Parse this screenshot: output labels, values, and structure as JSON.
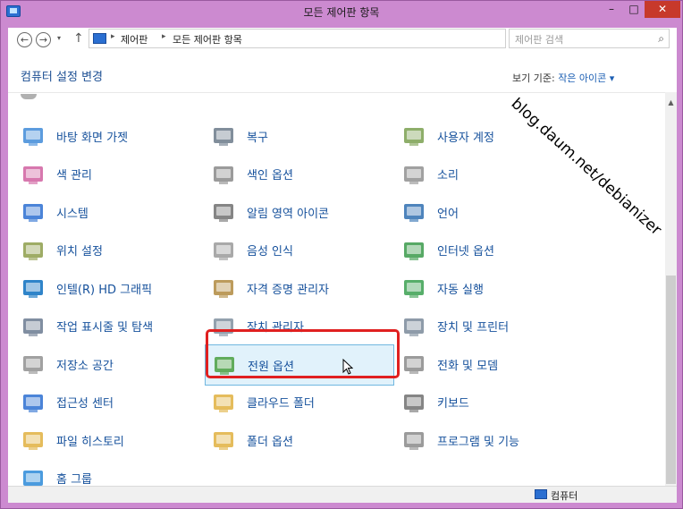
{
  "window": {
    "title": "모든 제어판 항목",
    "min": "–",
    "max": "□",
    "close": "✕"
  },
  "nav": {
    "back": "←",
    "forward": "→",
    "history": "▾",
    "up": "↑",
    "crumbs": [
      "제어판",
      "모든 제어판 항목"
    ],
    "separator": "▸",
    "dropdown": "⌄",
    "refresh": "↻",
    "search_placeholder": "제어판 검색",
    "search_icon": "⌕"
  },
  "heading": "컴퓨터 설정 변경",
  "view_by": {
    "label": "보기 기준:",
    "value": "작은 아이콘 ▾"
  },
  "items": [
    {
      "label": "바탕 화면 가젯",
      "icon": "gadgets-icon",
      "color": "#3f8bd8"
    },
    {
      "label": "복구",
      "icon": "recovery-icon",
      "color": "#6b7a8a"
    },
    {
      "label": "사용자 계정",
      "icon": "user-accounts-icon",
      "color": "#7aa050"
    },
    {
      "label": "색 관리",
      "icon": "color-management-icon",
      "color": "#d060a0"
    },
    {
      "label": "색인 옵션",
      "icon": "indexing-options-icon",
      "color": "#8a8a8a"
    },
    {
      "label": "소리",
      "icon": "sound-icon",
      "color": "#909090"
    },
    {
      "label": "시스템",
      "icon": "system-icon",
      "color": "#2b6fd1"
    },
    {
      "label": "알림 영역 아이콘",
      "icon": "notification-area-icon",
      "color": "#707070"
    },
    {
      "label": "언어",
      "icon": "language-icon",
      "color": "#2f6fb0"
    },
    {
      "label": "위치 설정",
      "icon": "location-settings-icon",
      "color": "#8d9d4a"
    },
    {
      "label": "음성 인식",
      "icon": "speech-recognition-icon",
      "color": "#9a9a9a"
    },
    {
      "label": "인터넷 옵션",
      "icon": "internet-options-icon",
      "color": "#3a9a4a"
    },
    {
      "label": "인텔(R) HD 그래픽",
      "icon": "intel-hd-graphics-icon",
      "color": "#0a6fc0"
    },
    {
      "label": "자격 증명 관리자",
      "icon": "credential-manager-icon",
      "color": "#b08a40"
    },
    {
      "label": "자동 실행",
      "icon": "autoplay-icon",
      "color": "#3aa050"
    },
    {
      "label": "작업 표시줄 및 탐색",
      "icon": "taskbar-navigation-icon",
      "color": "#6a7a90"
    },
    {
      "label": "장치 관리자",
      "icon": "device-manager-icon",
      "color": "#8090a0"
    },
    {
      "label": "장치 및 프린터",
      "icon": "devices-printers-icon",
      "color": "#7a8a9a"
    },
    {
      "label": "저장소 공간",
      "icon": "storage-spaces-icon",
      "color": "#909090"
    },
    {
      "label": "전원 옵션",
      "icon": "power-options-icon",
      "color": "#4aa040"
    },
    {
      "label": "전화 및 모뎀",
      "icon": "phone-modem-icon",
      "color": "#8a8a8a"
    },
    {
      "label": "접근성 센터",
      "icon": "ease-of-access-icon",
      "color": "#2b6fd1"
    },
    {
      "label": "클라우드 폴더",
      "icon": "work-folders-icon",
      "color": "#e0b040"
    },
    {
      "label": "키보드",
      "icon": "keyboard-icon",
      "color": "#707070"
    },
    {
      "label": "파일 히스토리",
      "icon": "file-history-icon",
      "color": "#e0b040"
    },
    {
      "label": "폴더 옵션",
      "icon": "folder-options-icon",
      "color": "#e0b040"
    },
    {
      "label": "프로그램 및 기능",
      "icon": "programs-features-icon",
      "color": "#8a8a8a"
    },
    {
      "label": "홈 그룹",
      "icon": "homegroup-icon",
      "color": "#2b8ad8"
    }
  ],
  "status": "컴퓨터",
  "watermark": "blog.daum.net/debianizer"
}
